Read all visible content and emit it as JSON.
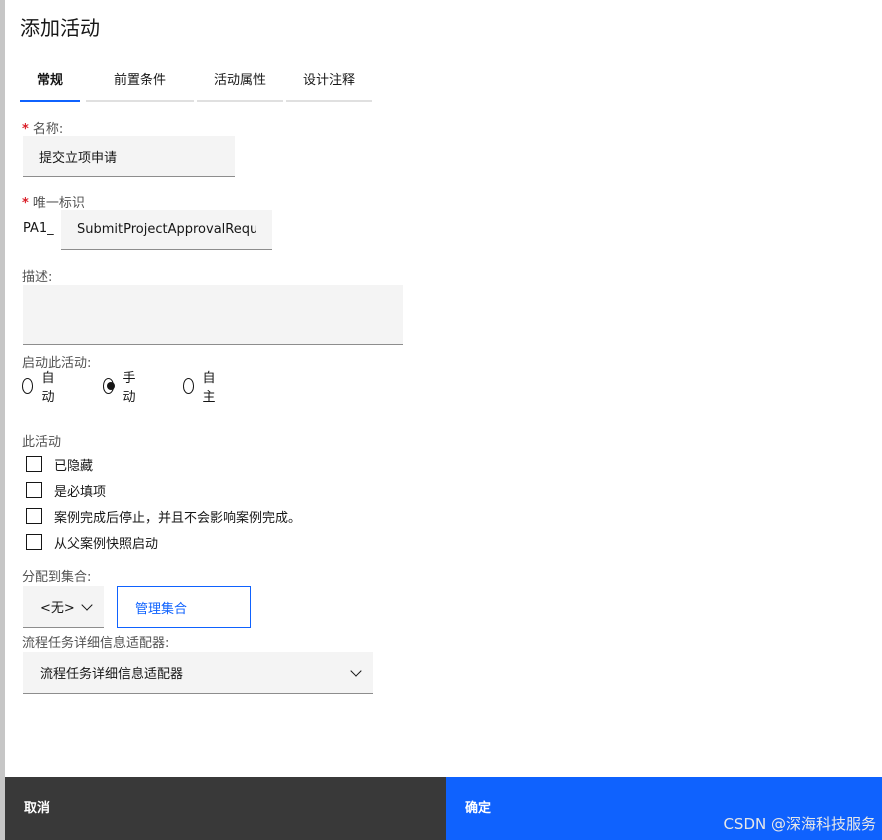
{
  "dialog": {
    "title": "添加活动"
  },
  "tabs": [
    {
      "label": "常规",
      "active": true
    },
    {
      "label": "前置条件",
      "active": false
    },
    {
      "label": "活动属性",
      "active": false
    },
    {
      "label": "设计注释",
      "active": false
    }
  ],
  "form": {
    "name": {
      "label": "名称:",
      "value": "提交立项申请"
    },
    "unique_id": {
      "label": "唯一标识",
      "prefix": "PA1_",
      "value": "SubmitProjectApprovalRequest"
    },
    "description": {
      "label": "描述:",
      "value": ""
    },
    "start": {
      "label": "启动此活动:",
      "options": [
        {
          "label": "自动",
          "checked": false
        },
        {
          "label": "手动",
          "checked": true
        },
        {
          "label": "自主",
          "checked": false
        }
      ]
    },
    "this_activity": {
      "label": "此活动",
      "checkboxes": [
        {
          "label": "已隐藏",
          "checked": false
        },
        {
          "label": "是必填项",
          "checked": false
        },
        {
          "label": "案例完成后停止，并且不会影响案例完成。",
          "checked": false
        },
        {
          "label": "从父案例快照启动",
          "checked": false
        }
      ]
    },
    "collection": {
      "label": "分配到集合:",
      "selected": "<无>",
      "manage_button": "管理集合"
    },
    "adapter": {
      "label": "流程任务详细信息适配器:",
      "selected": "流程任务详细信息适配器"
    }
  },
  "footer": {
    "cancel_label": "取消",
    "ok_label": "确定"
  },
  "watermark": "CSDN @深海科技服务",
  "colors": {
    "accent": "#0f62fe",
    "required": "#da1e28",
    "cancel_bg": "#393939"
  }
}
